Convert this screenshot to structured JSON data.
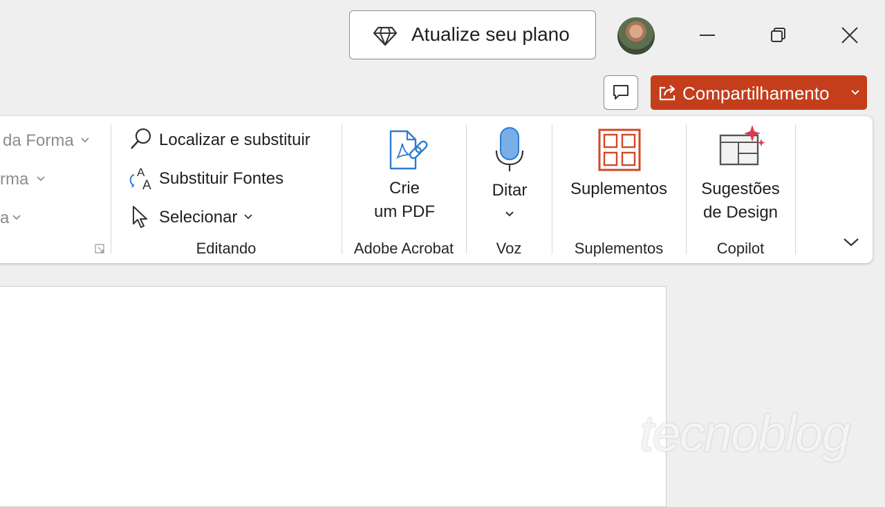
{
  "titlebar": {
    "upgrade_label": "Atualize seu plano",
    "share_label": "Compartilhamento",
    "share_color": "#c43e1c"
  },
  "ribbon": {
    "left_partial": {
      "item1": "da Forma",
      "item2": "rma",
      "item3": "a"
    },
    "editing": {
      "find_replace": "Localizar e substituir",
      "replace_fonts": "Substituir Fontes",
      "select": "Selecionar",
      "group_label": "Editando"
    },
    "acrobat": {
      "line1": "Crie",
      "line2": "um PDF",
      "group_label": "Adobe Acrobat"
    },
    "voice": {
      "dictate": "Ditar",
      "group_label": "Voz"
    },
    "addins": {
      "button": "Suplementos",
      "group_label": "Suplementos"
    },
    "copilot": {
      "line1": "Sugestões",
      "line2": "de Design",
      "group_label": "Copilot"
    },
    "accent_color": "#d24726"
  },
  "watermark": "tecnoblog",
  "icons": [
    "diamond-icon",
    "minimize-icon",
    "restore-icon",
    "close-icon",
    "comment-icon",
    "share-icon",
    "search-icon",
    "replace-fonts-icon",
    "cursor-icon",
    "pdf-link-icon",
    "microphone-icon",
    "addins-grid-icon",
    "design-ideas-icon",
    "expand-ribbon-icon",
    "dialog-launcher-icon"
  ]
}
